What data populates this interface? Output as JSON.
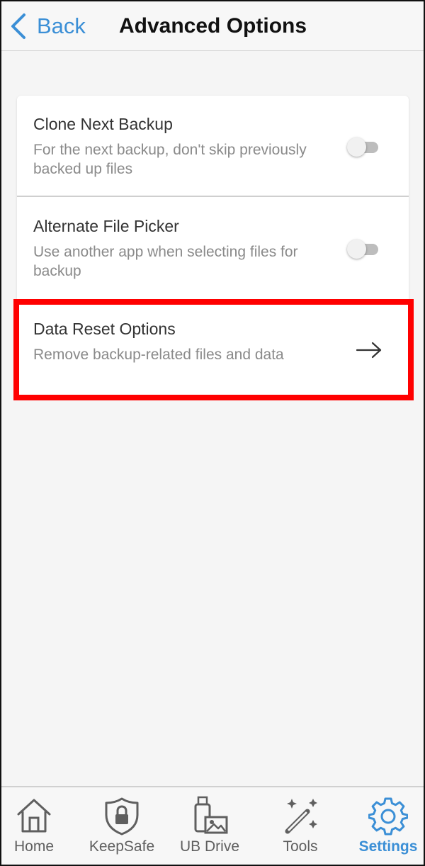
{
  "header": {
    "back_label": "Back",
    "title": "Advanced Options"
  },
  "settings": [
    {
      "title": "Clone Next Backup",
      "description": "For the next backup, don't skip previously backed up files",
      "control": "toggle",
      "enabled": false
    },
    {
      "title": "Alternate File Picker",
      "description": "Use another app when selecting files for backup",
      "control": "toggle",
      "enabled": false
    },
    {
      "title": "Data Reset Options",
      "description": "Remove backup-related files and data",
      "control": "arrow-right-icon",
      "highlighted": true
    }
  ],
  "tabs": [
    {
      "label": "Home",
      "icon": "home-icon",
      "active": false
    },
    {
      "label": "KeepSafe",
      "icon": "shield-lock-icon",
      "active": false
    },
    {
      "label": "UB Drive",
      "icon": "usb-drive-icon",
      "active": false
    },
    {
      "label": "Tools",
      "icon": "magic-wand-icon",
      "active": false
    },
    {
      "label": "Settings",
      "icon": "gear-icon",
      "active": true
    }
  ],
  "colors": {
    "accent": "#3b8fd6",
    "highlight": "#ff0000",
    "background": "#f5f5f5",
    "card": "#ffffff"
  }
}
